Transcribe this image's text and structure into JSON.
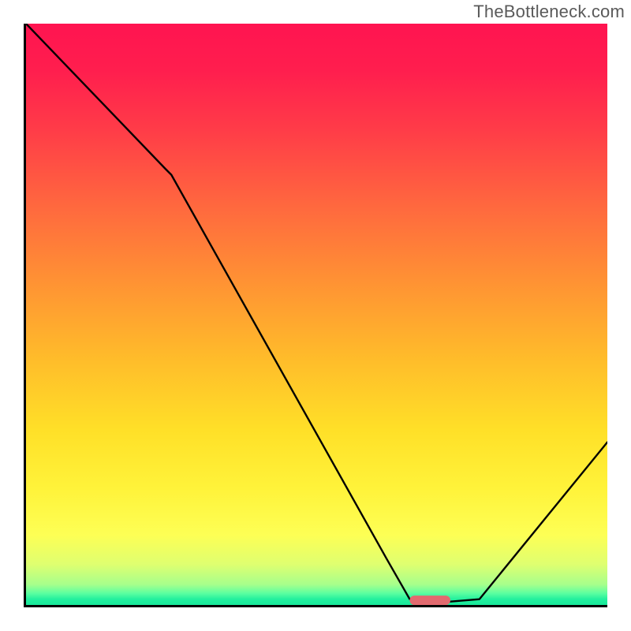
{
  "watermark": "TheBottleneck.com",
  "chart_data": {
    "type": "line",
    "title": "",
    "xlabel": "",
    "ylabel": "",
    "xlim": [
      0,
      100
    ],
    "ylim": [
      0,
      100
    ],
    "x": [
      0,
      24,
      25,
      62,
      66,
      72,
      78,
      100
    ],
    "values": [
      100,
      75,
      74,
      8,
      1,
      0.5,
      1,
      28
    ],
    "marker": {
      "x_start": 66,
      "x_end": 73,
      "y": 0.8,
      "color": "#e26a6f"
    },
    "gradient_stops": [
      {
        "pct": 0,
        "color": "#ff1450"
      },
      {
        "pct": 50,
        "color": "#ffa631"
      },
      {
        "pct": 85,
        "color": "#fdff55"
      },
      {
        "pct": 100,
        "color": "#18e89a"
      }
    ]
  }
}
